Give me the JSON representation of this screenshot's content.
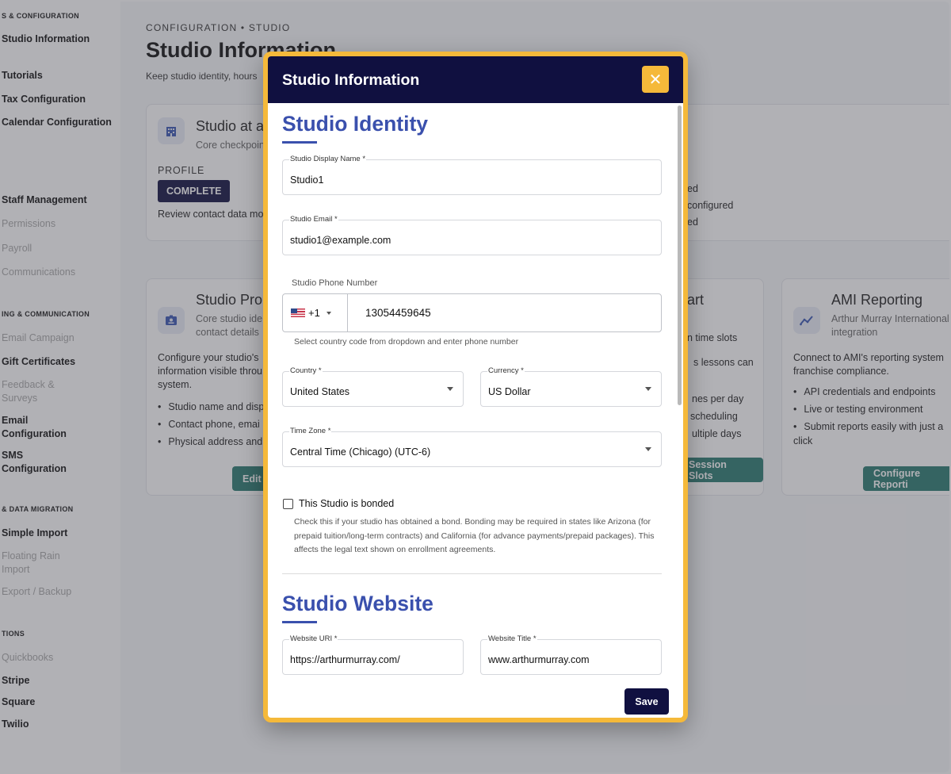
{
  "sidebar": {
    "sections": [
      {
        "label": "S & CONFIGURATION"
      },
      {
        "label": "ING & COMMUNICATION"
      },
      {
        "label": "& DATA MIGRATION"
      },
      {
        "label": "TIONS"
      }
    ],
    "items": [
      {
        "label": "Studio Information",
        "muted": false
      },
      {
        "label": "Tutorials",
        "muted": false
      },
      {
        "label": "Tax Configuration",
        "muted": false
      },
      {
        "label": "Calendar Configuration",
        "muted": false
      },
      {
        "label": "Staff Management",
        "muted": false
      },
      {
        "label": "Permissions",
        "muted": true
      },
      {
        "label": "Payroll",
        "muted": true
      },
      {
        "label": "Communications",
        "muted": true
      },
      {
        "label": "Email Campaign",
        "muted": true
      },
      {
        "label": "Gift Certificates",
        "muted": false
      },
      {
        "label": "Feedback & Surveys",
        "muted": true
      },
      {
        "label": "Email Configuration",
        "muted": false
      },
      {
        "label": "SMS Configuration",
        "muted": false
      },
      {
        "label": "Simple Import",
        "muted": false
      },
      {
        "label": "Floating Rain Import",
        "muted": true
      },
      {
        "label": "Export / Backup",
        "muted": true
      },
      {
        "label": "Quickbooks",
        "muted": true
      },
      {
        "label": "Stripe",
        "muted": false
      },
      {
        "label": "Square",
        "muted": false
      },
      {
        "label": "Twilio",
        "muted": false
      }
    ]
  },
  "page": {
    "breadcrumb": "CONFIGURATION • STUDIO",
    "title": "Studio Information",
    "subtitle": "Keep studio identity, hours"
  },
  "cards": {
    "glance": {
      "title": "Studio at a",
      "subtitle": "Core checkpoin",
      "profile_label": "PROFILE",
      "badge": "COMPLETE",
      "text": "Review contact data mo",
      "right_lines": [
        "ed",
        "configured",
        "ed"
      ]
    },
    "profile": {
      "title": "Studio Pro",
      "subtitle": "Core studio ide contact details",
      "description": "Configure your studio's information visible throu system.",
      "bullets": [
        "Studio name and disp",
        "Contact phone, emai",
        "Physical address and"
      ],
      "button": "Edit"
    },
    "chart": {
      "title": "art",
      "subtitle": "n time slots",
      "description": "s lessons can",
      "bullets": [
        "nes per day",
        "scheduling",
        "ultiple days"
      ],
      "button": "Session Slots"
    },
    "ami": {
      "title": "AMI Reporting",
      "subtitle": "Arthur Murray International integration",
      "description": "Connect to AMI's reporting system franchise compliance.",
      "bullets": [
        "API credentials and endpoints",
        "Live or testing environment",
        "Submit reports easily with just a click"
      ],
      "button": "Configure Reporti"
    }
  },
  "modal": {
    "title": "Studio Information",
    "close_symbol": "✕",
    "identity": {
      "heading": "Studio Identity",
      "display_name": {
        "label": "Studio Display Name *",
        "value": "Studio1"
      },
      "email": {
        "label": "Studio Email *",
        "value": "studio1@example.com"
      },
      "phone": {
        "label": "Studio Phone Number",
        "country_code": "+1",
        "number": "13054459645",
        "help": "Select country code from dropdown and enter phone number"
      },
      "country": {
        "label": "Country *",
        "value": "United States"
      },
      "currency": {
        "label": "Currency *",
        "value": "US Dollar"
      },
      "timezone": {
        "label": "Time Zone *",
        "value": "Central Time (Chicago) (UTC-6)"
      },
      "bonded": {
        "label": "This Studio is bonded",
        "checked": false,
        "help": "Check this if your studio has obtained a bond. Bonding may be required in states like Arizona (for prepaid tuition/long-term contracts) and California (for advance payments/prepaid packages). This affects the legal text shown on enrollment agreements."
      }
    },
    "website": {
      "heading": "Studio Website",
      "url": {
        "label": "Website URI *",
        "value": "https://arthurmurray.com/"
      },
      "title": {
        "label": "Website Title *",
        "value": "www.arthurmurray.com"
      }
    },
    "save_label": "Save"
  },
  "colors": {
    "navy": "#101040",
    "accent_yellow": "#f5b93a",
    "heading_blue": "#3a50ad",
    "teal": "#2a7a70"
  }
}
